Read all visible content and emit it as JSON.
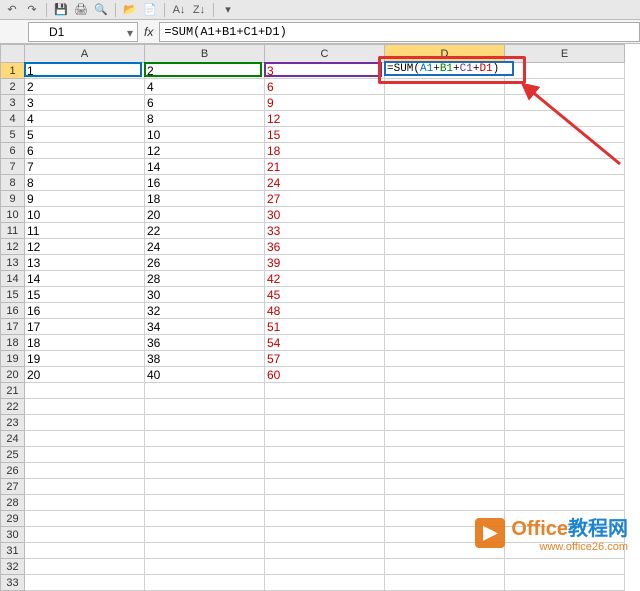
{
  "toolbar": {},
  "namebox": {
    "value": "D1"
  },
  "formula_bar": {
    "value": "=SUM(A1+B1+C1+D1)"
  },
  "cell_edit": {
    "prefix": "=SUM(",
    "a": "A1",
    "plus": "+",
    "b": "B1",
    "c": "C1",
    "d": "D1",
    "suffix": ")"
  },
  "columns": [
    "A",
    "B",
    "C",
    "D",
    "E"
  ],
  "rows": [
    {
      "n": 1,
      "a": "1",
      "b": "2",
      "c": "3"
    },
    {
      "n": 2,
      "a": "2",
      "b": "4",
      "c": "6"
    },
    {
      "n": 3,
      "a": "3",
      "b": "6",
      "c": "9"
    },
    {
      "n": 4,
      "a": "4",
      "b": "8",
      "c": "12"
    },
    {
      "n": 5,
      "a": "5",
      "b": "10",
      "c": "15"
    },
    {
      "n": 6,
      "a": "6",
      "b": "12",
      "c": "18"
    },
    {
      "n": 7,
      "a": "7",
      "b": "14",
      "c": "21"
    },
    {
      "n": 8,
      "a": "8",
      "b": "16",
      "c": "24"
    },
    {
      "n": 9,
      "a": "9",
      "b": "18",
      "c": "27"
    },
    {
      "n": 10,
      "a": "10",
      "b": "20",
      "c": "30"
    },
    {
      "n": 11,
      "a": "11",
      "b": "22",
      "c": "33"
    },
    {
      "n": 12,
      "a": "12",
      "b": "24",
      "c": "36"
    },
    {
      "n": 13,
      "a": "13",
      "b": "26",
      "c": "39"
    },
    {
      "n": 14,
      "a": "14",
      "b": "28",
      "c": "42"
    },
    {
      "n": 15,
      "a": "15",
      "b": "30",
      "c": "45"
    },
    {
      "n": 16,
      "a": "16",
      "b": "32",
      "c": "48"
    },
    {
      "n": 17,
      "a": "17",
      "b": "34",
      "c": "51"
    },
    {
      "n": 18,
      "a": "18",
      "b": "36",
      "c": "54"
    },
    {
      "n": 19,
      "a": "19",
      "b": "38",
      "c": "57"
    },
    {
      "n": 20,
      "a": "20",
      "b": "40",
      "c": "60"
    },
    {
      "n": 21
    },
    {
      "n": 22
    },
    {
      "n": 23
    },
    {
      "n": 24
    },
    {
      "n": 25
    },
    {
      "n": 26
    },
    {
      "n": 27
    },
    {
      "n": 28
    },
    {
      "n": 29
    },
    {
      "n": 30
    },
    {
      "n": 31
    },
    {
      "n": 32
    },
    {
      "n": 33
    }
  ],
  "watermark": {
    "brand1": "Office",
    "brand2": "教程网",
    "url": "www.office26.com"
  },
  "chart_data": {
    "type": "table",
    "columns": [
      "A",
      "B",
      "C"
    ],
    "series": [
      {
        "name": "A",
        "values": [
          1,
          2,
          3,
          4,
          5,
          6,
          7,
          8,
          9,
          10,
          11,
          12,
          13,
          14,
          15,
          16,
          17,
          18,
          19,
          20
        ]
      },
      {
        "name": "B",
        "values": [
          2,
          4,
          6,
          8,
          10,
          12,
          14,
          16,
          18,
          20,
          22,
          24,
          26,
          28,
          30,
          32,
          34,
          36,
          38,
          40
        ]
      },
      {
        "name": "C",
        "values": [
          3,
          6,
          9,
          12,
          15,
          18,
          21,
          24,
          27,
          30,
          33,
          36,
          39,
          42,
          45,
          48,
          51,
          54,
          57,
          60
        ]
      }
    ],
    "active_cell": "D1",
    "active_formula": "=SUM(A1+B1+C1+D1)"
  }
}
